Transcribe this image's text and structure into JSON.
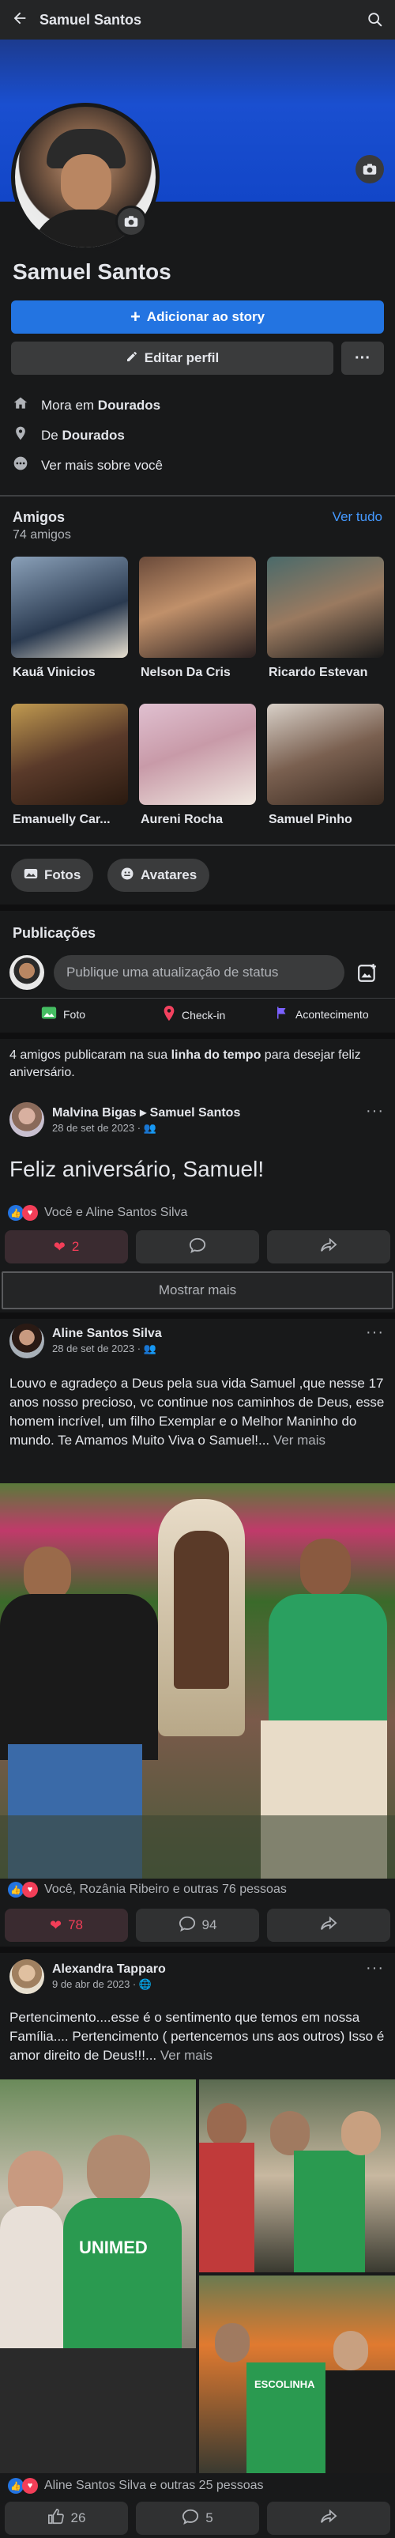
{
  "header": {
    "back_icon": "arrow-left-icon",
    "title": "Samuel Santos",
    "search_icon": "search-icon"
  },
  "profile": {
    "name": "Samuel Santos",
    "add_story": "Adicionar ao story",
    "edit_profile": "Editar perfil",
    "more": "···",
    "info": [
      {
        "icon": "house-icon",
        "prefix": "Mora em ",
        "bold": "Dourados"
      },
      {
        "icon": "location-pin-icon",
        "prefix": "De ",
        "bold": "Dourados"
      },
      {
        "icon": "more-dots-icon",
        "prefix": "Ver mais sobre você",
        "bold": ""
      }
    ]
  },
  "friends": {
    "title": "Amigos",
    "count": "74 amigos",
    "see_all": "Ver tudo",
    "items": [
      {
        "name": "Kauã Vinicios",
        "color": "#6b7a8f"
      },
      {
        "name": "Nelson Da Cris",
        "color": "#7a5a4a"
      },
      {
        "name": "Ricardo Estevan",
        "color": "#3d5a5a"
      },
      {
        "name": "Emanuelly Car...",
        "color": "#5a4a3a"
      },
      {
        "name": "Aureni Rocha",
        "color": "#b88a9a"
      },
      {
        "name": "Samuel Pinho",
        "color": "#6a5a50"
      }
    ]
  },
  "tabs": [
    {
      "label": "Fotos",
      "icon": "photos-icon"
    },
    {
      "label": "Avatares",
      "icon": "avatar-icon"
    }
  ],
  "publications": {
    "title": "Publicações",
    "placeholder": "Publique uma atualização de status",
    "actions": [
      {
        "label": "Foto",
        "icon": "photo-icon",
        "color": "#45bd62"
      },
      {
        "label": "Check-in",
        "icon": "checkin-icon",
        "color": "#f3425f"
      },
      {
        "label": "Acontecimento",
        "icon": "flag-icon",
        "color": "#7b61ff"
      }
    ]
  },
  "birthday_notice": {
    "prefix": "4 amigos publicaram na sua ",
    "bold": "linha do tempo",
    "suffix": " para desejar feliz aniversário."
  },
  "post1": {
    "author": "Malvina Bigas",
    "arrow": "▸",
    "target": "Samuel Santos",
    "date": "28 de set de 2023 ·",
    "text": "Feliz aniversário, Samuel!",
    "reactions": "Você e Aline Santos Silva",
    "likes": "2"
  },
  "show_more": "Mostrar mais",
  "post2": {
    "author": "Aline Santos Silva",
    "date": "28 de set de 2023 ·",
    "text": "Louvo e agradeço a Deus pela sua vida Samuel ,que nesse 17 anos nosso precioso, vc continue nos caminhos de Deus, esse homem incrível, um filho Exemplar e o Melhor Maninho do mundo. Te Amamos Muito Viva o Samuel!...",
    "see_more": "Ver mais",
    "reactions": "Você, Rozânia Ribeiro e outras 76 pessoas",
    "likes": "78",
    "comments": "94"
  },
  "post3": {
    "author": "Alexandra Tapparo",
    "date": "9 de abr de 2023 ·",
    "text": "Pertencimento....esse é o sentimento que temos em nossa Família.... Pertencimento ( pertencemos uns aos outros) Isso é amor direito de Deus!!!...",
    "see_more": "Ver mais",
    "reactions": "Aline Santos Silva e outras 25 pessoas",
    "likes": "26",
    "comments": "5",
    "banner_text_1": "UNIMED",
    "banner_text_2": "ESCOLINHA"
  }
}
